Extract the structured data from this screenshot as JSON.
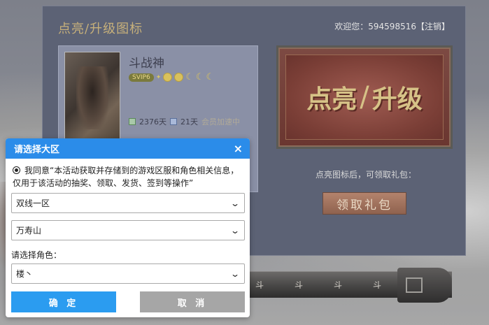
{
  "page": {
    "title": "点亮/升级图标",
    "welcome_prefix": "欢迎您：",
    "username": "594598516",
    "logout": "【注销】"
  },
  "card": {
    "name": "斗战神",
    "vip": "SVIP6",
    "days": "2376天",
    "level_days": "21天",
    "speedup": "会员加速中"
  },
  "banner": {
    "part1": "点亮",
    "part2": "升级"
  },
  "reward": {
    "hint": "点亮图标后，可领取礼包：",
    "claim_label": "领取礼包"
  },
  "scroll": {
    "icons": [
      "斗",
      "斗",
      "斗",
      "斗"
    ]
  },
  "dialog": {
    "title": "请选择大区",
    "close": "×",
    "agreement": "我同意“本活动获取并存储到的游戏区服和角色相关信息，仅用于该活动的抽奖、领取、发货、签到等操作”",
    "region": "双线一区",
    "server": "万寿山",
    "role_label": "请选择角色：",
    "role": "楼丶",
    "confirm": "确 定",
    "cancel": "取 消"
  },
  "colors": {
    "dialog_header": "#2b8ce9",
    "confirm_button": "#2b9cf0",
    "cancel_button": "#a6a6a6",
    "panel": "#5c6275",
    "title_gold": "#c7b07a"
  }
}
